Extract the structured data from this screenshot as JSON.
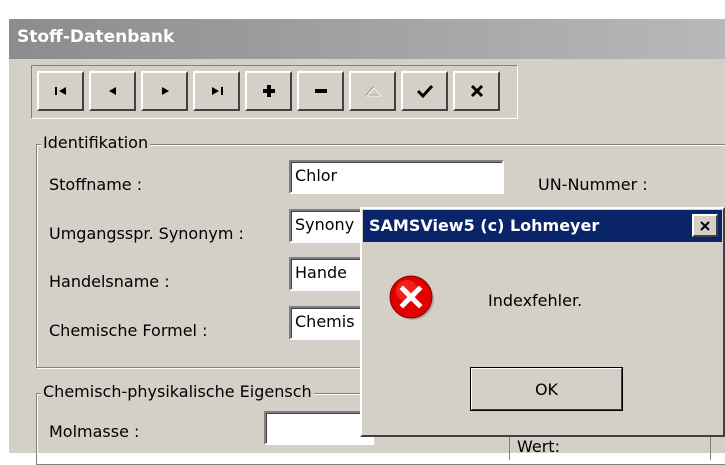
{
  "window": {
    "title": "Stoff-Datenbank"
  },
  "toolbar": {
    "buttons": [
      {
        "name": "first-record-button",
        "icon": "first-icon"
      },
      {
        "name": "prior-record-button",
        "icon": "prior-icon"
      },
      {
        "name": "next-record-button",
        "icon": "next-icon"
      },
      {
        "name": "last-record-button",
        "icon": "last-icon"
      },
      {
        "name": "insert-record-button",
        "icon": "plus-icon"
      },
      {
        "name": "delete-record-button",
        "icon": "minus-icon"
      },
      {
        "name": "edit-record-button",
        "icon": "triangle-up-icon"
      },
      {
        "name": "post-record-button",
        "icon": "checkmark-icon"
      },
      {
        "name": "cancel-record-button",
        "icon": "x-icon"
      }
    ]
  },
  "identifikation": {
    "group_label": "Identifikation",
    "stoffname_label": "Stoffname :",
    "stoffname_value": "Chlor",
    "un_nummer_label": "UN-Nummer :",
    "synonym_label": "Umgangsspr. Synonym :",
    "synonym_value": "Synony",
    "handelsname_label": "Handelsname :",
    "handelsname_value": "Hande",
    "formel_label": "Chemische Formel :",
    "formel_value": "Chemis"
  },
  "eigenschaften": {
    "group_label": "Chemisch-physikalische Eigensch",
    "molmasse_label": "Molmasse :",
    "molmasse_value": "",
    "wert_label": "Wert:"
  },
  "dialog": {
    "title": "SAMSView5 (c) Lohmeyer",
    "message": "Indexfehler.",
    "ok_label": "OK",
    "icon": "error-icon",
    "title_color": "#0a246a"
  }
}
